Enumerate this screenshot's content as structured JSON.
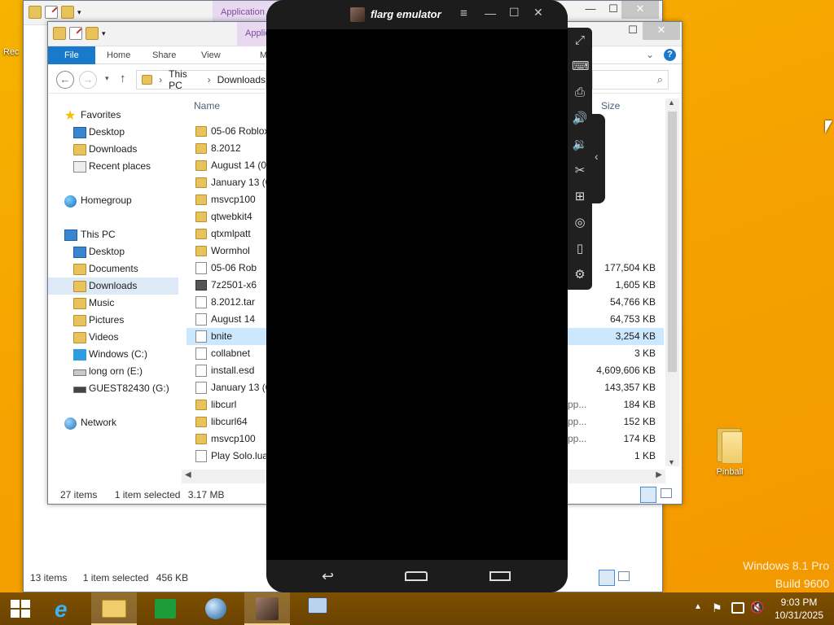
{
  "desktop": {
    "icons": [
      {
        "label": "Pinball"
      },
      {
        "label": "Rec"
      }
    ],
    "watermark": {
      "line1": "Windows 8.1 Pro",
      "line2": "Build 9600"
    }
  },
  "back_window": {
    "apptools_label": "Application",
    "status": {
      "items": "13 items",
      "selection": "1 item selected",
      "size": "456 KB"
    }
  },
  "explorer": {
    "apptools_label": "Applic",
    "ribbon_tabs": [
      "File",
      "Home",
      "Share",
      "View",
      "M"
    ],
    "breadcrumb": [
      "This PC",
      "Downloads"
    ],
    "nav": {
      "favorites": "Favorites",
      "favorites_items": [
        "Desktop",
        "Downloads",
        "Recent places"
      ],
      "homegroup": "Homegroup",
      "thispc": "This PC",
      "thispc_items": [
        "Desktop",
        "Documents",
        "Downloads",
        "Music",
        "Pictures",
        "Videos",
        "Windows (C:)",
        "long orn (E:)",
        "GUEST82430 (G:)"
      ],
      "network": "Network"
    },
    "columns": {
      "name": "Name",
      "size": "Size"
    },
    "files": [
      {
        "name": "05-06 Roblox",
        "type": "folder",
        "size": "",
        "extra": ""
      },
      {
        "name": "8.2012",
        "type": "folder",
        "size": "",
        "extra": ""
      },
      {
        "name": "August 14 (0...",
        "type": "folder",
        "size": "",
        "extra": ""
      },
      {
        "name": "January 13 (0...",
        "type": "folder",
        "size": "",
        "extra": ""
      },
      {
        "name": "msvcp100",
        "type": "folder",
        "size": "",
        "extra": ""
      },
      {
        "name": "qtwebkit4",
        "type": "folder",
        "size": "",
        "extra": ""
      },
      {
        "name": "qtxmlpatt",
        "type": "folder",
        "size": "",
        "extra": ""
      },
      {
        "name": "Wormhol",
        "type": "folder",
        "size": "",
        "extra": ""
      },
      {
        "name": "05-06 Rob",
        "type": "file",
        "size": "177,504 KB",
        "extra": ""
      },
      {
        "name": "7z2501-x6",
        "type": "exe",
        "size": "1,605 KB",
        "extra": ""
      },
      {
        "name": "8.2012.tar",
        "type": "file",
        "size": "54,766 KB",
        "extra": ""
      },
      {
        "name": "August 14",
        "type": "file",
        "size": "64,753 KB",
        "extra": ""
      },
      {
        "name": "bnite",
        "type": "file",
        "size": "3,254 KB",
        "extra": ""
      },
      {
        "name": "collabnet",
        "type": "file",
        "size": "3 KB",
        "extra": ""
      },
      {
        "name": "install.esd",
        "type": "file",
        "size": "4,609,606 KB",
        "extra": ""
      },
      {
        "name": "January 13 (0",
        "type": "file",
        "size": "143,357 KB",
        "extra": ""
      },
      {
        "name": "libcurl",
        "type": "folder",
        "size": "184 KB",
        "extra": "pp..."
      },
      {
        "name": "libcurl64",
        "type": "folder",
        "size": "152 KB",
        "extra": "pp..."
      },
      {
        "name": "msvcp100",
        "type": "folder",
        "size": "174 KB",
        "extra": "pp..."
      },
      {
        "name": "Play Solo.lua",
        "type": "file",
        "size": "1 KB",
        "extra": ""
      }
    ],
    "status": {
      "items": "27 items",
      "selection": "1 item selected",
      "size": "3.17 MB"
    }
  },
  "emulator": {
    "title": "flarg emulator",
    "side_icons": [
      "fullscreen-icon",
      "keyboard-icon",
      "apk-icon",
      "volume-up-icon",
      "volume-down-icon",
      "scissors-icon",
      "multi-window-icon",
      "location-icon",
      "shake-icon",
      "settings-icon"
    ]
  },
  "taskbar": {
    "time": "9:03 PM",
    "date": "10/31/2025"
  }
}
